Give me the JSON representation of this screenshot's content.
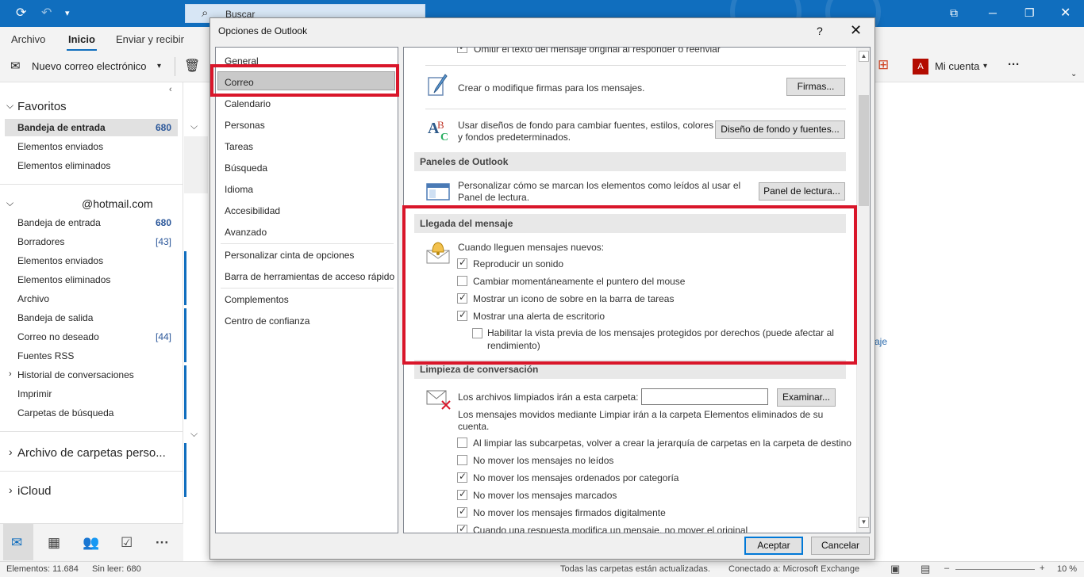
{
  "search": {
    "placeholder": "Buscar"
  },
  "ribbon": {
    "tabs": [
      "Archivo",
      "Inicio",
      "Enviar y recibir"
    ],
    "active_tab": "Inicio",
    "new_email": "Nuevo correo electrónico",
    "my_account": "Mi cuenta",
    "more": "···"
  },
  "nav": {
    "favorites_header": "Favoritos",
    "favorites": [
      {
        "label": "Bandeja de entrada",
        "count": "680",
        "selected": true
      },
      {
        "label": "Elementos enviados",
        "count": ""
      },
      {
        "label": "Elementos eliminados",
        "count": ""
      }
    ],
    "account_header": "@hotmail.com",
    "account_items": [
      {
        "label": "Bandeja de entrada",
        "count": "680"
      },
      {
        "label": "Borradores",
        "count": "[43]"
      },
      {
        "label": "Elementos enviados",
        "count": ""
      },
      {
        "label": "Elementos eliminados",
        "count": ""
      },
      {
        "label": "Archivo",
        "count": ""
      },
      {
        "label": "Bandeja de salida",
        "count": ""
      },
      {
        "label": "Correo no deseado",
        "count": "[44]"
      },
      {
        "label": "Fuentes RSS",
        "count": ""
      },
      {
        "label": "Historial de conversaciones",
        "count": ""
      },
      {
        "label": "Imprimir",
        "count": ""
      },
      {
        "label": "Carpetas de búsqueda",
        "count": ""
      }
    ],
    "archive_header": "Archivo de carpetas perso...",
    "icloud_header": "iCloud"
  },
  "reading_pane": {
    "link_fragment": "aje"
  },
  "status": {
    "items": "Elementos: 11.684",
    "unread": "Sin leer: 680",
    "updated": "Todas las carpetas están actualizadas.",
    "connection": "Conectado a: Microsoft Exchange",
    "zoom": "10 %"
  },
  "dialog": {
    "title": "Opciones de Outlook",
    "help": "?",
    "categories": [
      "General",
      "Correo",
      "Calendario",
      "Personas",
      "Tareas",
      "Búsqueda",
      "Idioma",
      "Accesibilidad",
      "Avanzado",
      "Personalizar cinta de opciones",
      "Barra de herramientas de acceso rápido",
      "Complementos",
      "Centro de confianza"
    ],
    "selected_category": "Correo",
    "top_clipped_text": "Omitir el texto del mensaje original al responder o reenviar",
    "signatures_text": "Crear o modifique firmas para los mensajes.",
    "signatures_button": "Firmas...",
    "stationery_text_1": "Usar diseños de fondo para cambiar fuentes, estilos, colores",
    "stationery_text_2": "y fondos predeterminados.",
    "stationery_button": "Diseño de fondo y fuentes...",
    "panes_header": "Paneles de Outlook",
    "panes_text_1": "Personalizar cómo se marcan los elementos como leídos al usar el",
    "panes_text_2": "Panel de lectura.",
    "panes_button": "Panel de lectura...",
    "arrival_header": "Llegada del mensaje",
    "arrival_intro": "Cuando lleguen mensajes nuevos:",
    "arrival_options": [
      {
        "label": "Reproducir un sonido",
        "checked": true
      },
      {
        "label": "Cambiar momentáneamente el puntero del mouse",
        "checked": false
      },
      {
        "label": "Mostrar un icono de sobre en la barra de tareas",
        "checked": true
      },
      {
        "label": "Mostrar una alerta de escritorio",
        "checked": true
      }
    ],
    "arrival_sub_option_1": "Habilitar la vista previa de los mensajes protegidos por derechos (puede afectar al",
    "arrival_sub_option_2": "rendimiento)",
    "arrival_sub_checked": false,
    "cleanup_header": "Limpieza de conversación",
    "cleanup_folder_label": "Los archivos limpiados irán a esta carpeta:",
    "cleanup_folder_value": "",
    "browse_button": "Examinar...",
    "cleanup_note_1": "Los mensajes movidos mediante Limpiar irán a la carpeta Elementos eliminados de su",
    "cleanup_note_2": "cuenta.",
    "cleanup_options": [
      {
        "label": "Al limpiar las subcarpetas, volver a crear la jerarquía de carpetas en la carpeta de destino",
        "checked": false
      },
      {
        "label": "No mover los mensajes no leídos",
        "checked": false
      },
      {
        "label": "No mover los mensajes ordenados por categoría",
        "checked": true
      },
      {
        "label": "No mover los mensajes marcados",
        "checked": true
      },
      {
        "label": "No mover los mensajes firmados digitalmente",
        "checked": true
      },
      {
        "label": "Cuando una respuesta modifica un mensaje, no mover el original",
        "checked": true
      }
    ],
    "ok_button": "Aceptar",
    "cancel_button": "Cancelar"
  },
  "colors": {
    "accent": "#106ebe",
    "highlight": "#d9162a"
  }
}
